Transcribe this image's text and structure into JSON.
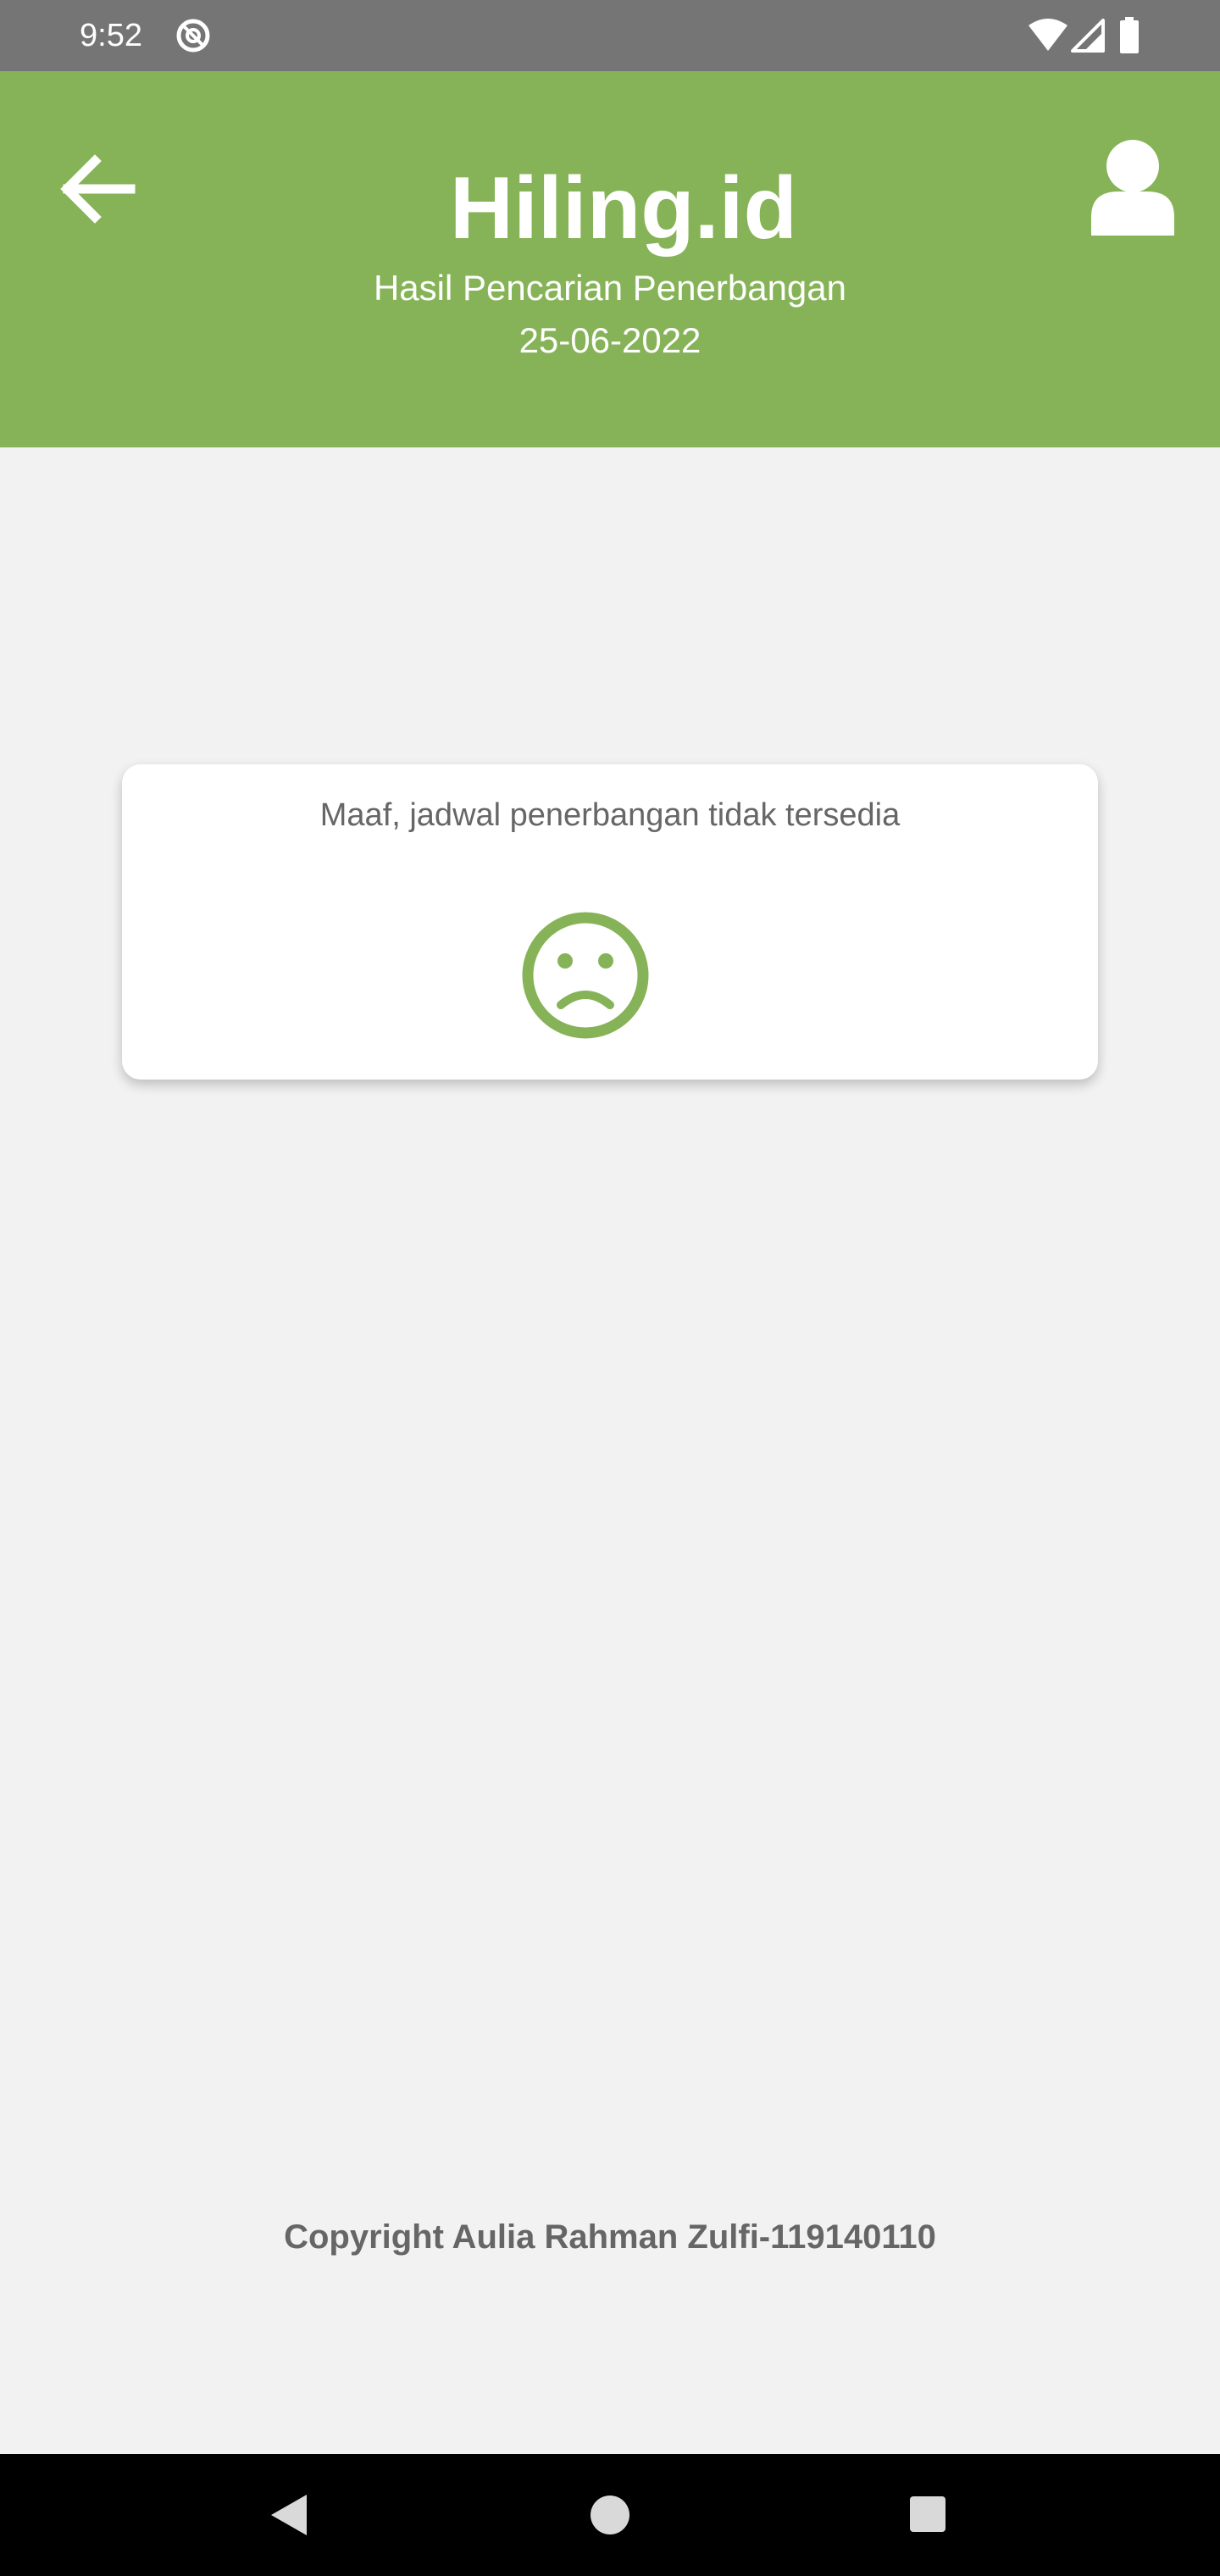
{
  "status_bar": {
    "time": "9:52",
    "icons": [
      "data-saver-icon",
      "wifi-icon",
      "signal-icon",
      "battery-icon"
    ]
  },
  "header": {
    "title": "Hiling.id",
    "subtitle": "Hasil Pencarian Penerbangan",
    "date": "25-06-2022",
    "back_icon": "arrow-left-icon",
    "profile_icon": "user-icon"
  },
  "empty_state": {
    "message": "Maaf, jadwal penerbangan tidak tersedia",
    "icon": "sad-face-icon"
  },
  "footer": {
    "copyright": "Copyright Aulia Rahman Zulfi-119140110"
  },
  "nav_bar": {
    "buttons": [
      "back-triangle-icon",
      "home-circle-icon",
      "recents-square-icon"
    ]
  },
  "colors": {
    "header_green": "#86b357",
    "status_bar": "#757575",
    "background": "#f2f2f2",
    "text_gray": "#666666"
  }
}
